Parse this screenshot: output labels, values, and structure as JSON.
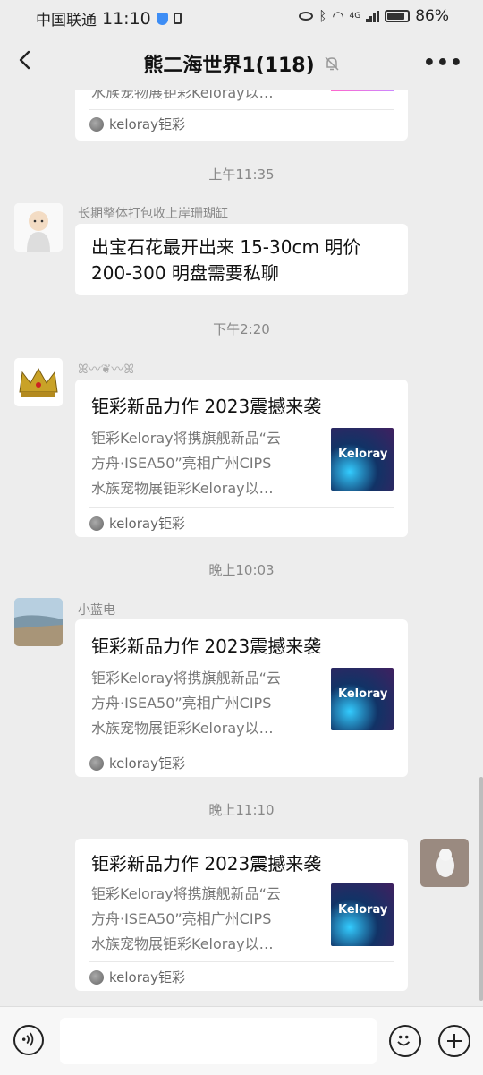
{
  "status_bar": {
    "carrier": "中国联通",
    "time": "11:10",
    "network": "4G",
    "battery": "86%",
    "battery_level": 0.86
  },
  "header": {
    "title": "熊二海世界1(118)"
  },
  "messages": [
    {
      "source": "keloray钜彩",
      "partial_text": "水族宠物展钜彩Keloray以…"
    },
    {
      "timestamp": "上午11:35"
    },
    {
      "sender": "长期整体打包收上岸珊瑚缸",
      "text": "出宝石花最开出来 15-30cm 明价 200-300 明盘需要私聊"
    },
    {
      "timestamp": "下午2:20"
    },
    {
      "card": {
        "title": "钜彩新品力作 2023震撼来袭",
        "desc_lines": [
          "钜彩Keloray将携旗舰新品“云",
          "方舟·ISEA50”亮相广州CIPS",
          "水族宠物展钜彩Keloray以…"
        ],
        "thumb_text": "Keloray",
        "source": "keloray钜彩"
      }
    },
    {
      "timestamp": "晚上10:03"
    },
    {
      "sender": "小蓝电",
      "card": {
        "title": "钜彩新品力作 2023震撼来袭",
        "desc_lines": [
          "钜彩Keloray将携旗舰新品“云",
          "方舟·ISEA50”亮相广州CIPS",
          "水族宠物展钜彩Keloray以…"
        ],
        "thumb_text": "Keloray",
        "source": "keloray钜彩"
      }
    },
    {
      "timestamp": "晚上11:10"
    },
    {
      "card": {
        "title": "钜彩新品力作 2023震撼来袭",
        "desc_lines": [
          "钜彩Keloray将携旗舰新品“云",
          "方舟·ISEA50”亮相广州CIPS",
          "水族宠物展钜彩Keloray以…"
        ],
        "thumb_text": "Keloray",
        "source": "keloray钜彩"
      }
    }
  ]
}
